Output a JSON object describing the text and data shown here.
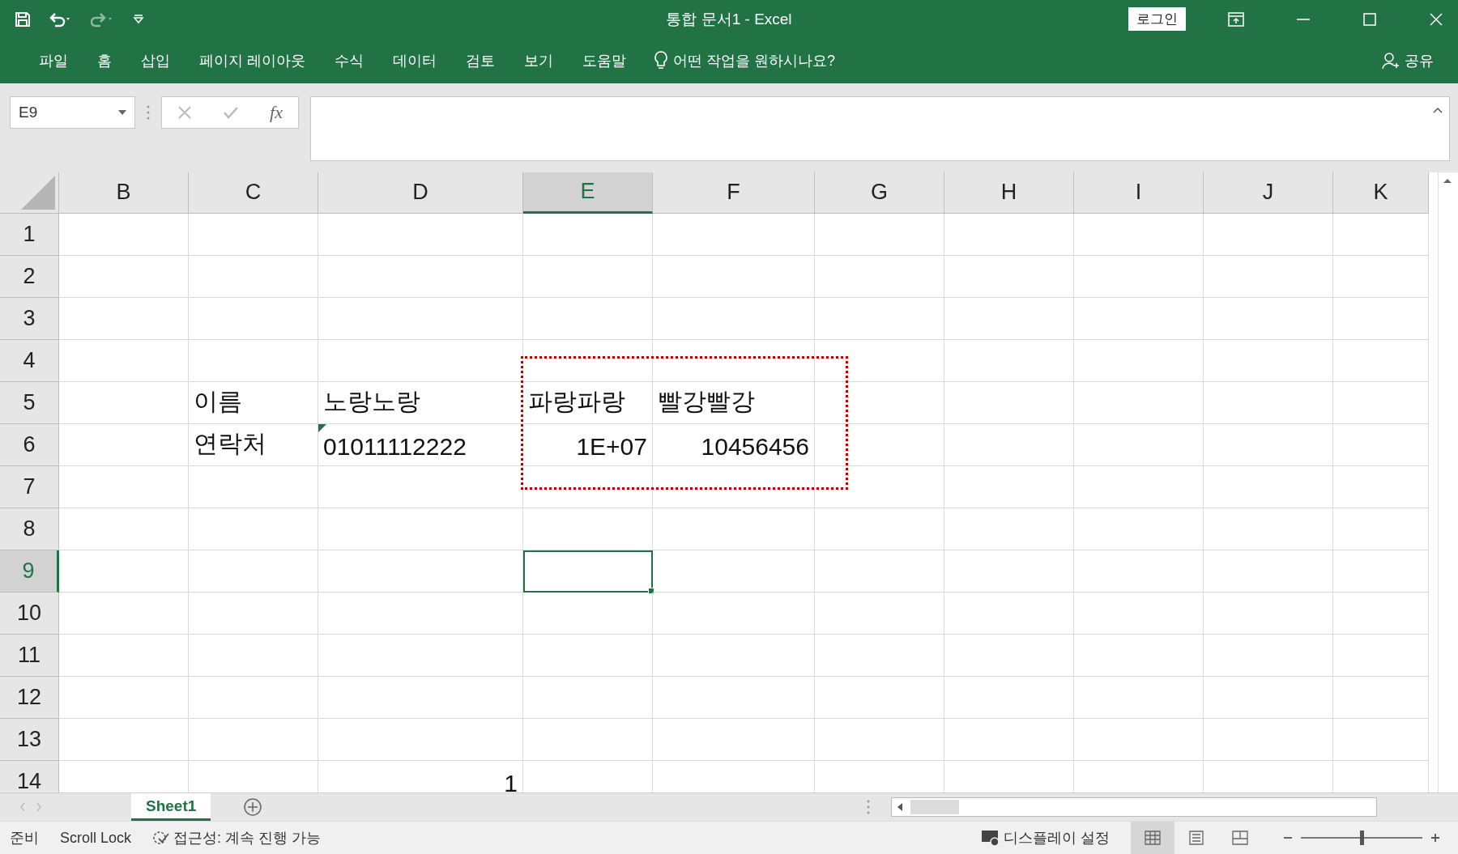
{
  "window": {
    "title": "통합 문서1  -  Excel",
    "login_button": "로그인"
  },
  "ribbon_tabs": [
    "파일",
    "홈",
    "삽입",
    "페이지 레이아웃",
    "수식",
    "데이터",
    "검토",
    "보기",
    "도움말"
  ],
  "tell_me": "어떤 작업을 원하시나요?",
  "share": "공유",
  "name_box": "E9",
  "function_label": "fx",
  "columns": [
    {
      "label": "B",
      "selected": false
    },
    {
      "label": "C",
      "selected": false
    },
    {
      "label": "D",
      "selected": false
    },
    {
      "label": "E",
      "selected": true
    },
    {
      "label": "F",
      "selected": false
    },
    {
      "label": "G",
      "selected": false
    },
    {
      "label": "H",
      "selected": false
    },
    {
      "label": "I",
      "selected": false
    },
    {
      "label": "J",
      "selected": false
    },
    {
      "label": "K",
      "selected": false
    }
  ],
  "rows": [
    {
      "label": "1",
      "selected": false
    },
    {
      "label": "2",
      "selected": false
    },
    {
      "label": "3",
      "selected": false
    },
    {
      "label": "4",
      "selected": false
    },
    {
      "label": "5",
      "selected": false,
      "cells": [
        null,
        {
          "text": "이름",
          "numeric": false
        },
        {
          "text": "노랑노랑",
          "numeric": false
        },
        {
          "text": "파랑파랑",
          "numeric": false
        },
        {
          "text": "빨강빨강",
          "numeric": false
        }
      ]
    },
    {
      "label": "6",
      "selected": false,
      "cells": [
        null,
        {
          "text": "연락처",
          "numeric": false
        },
        {
          "text": "01011112222",
          "numeric": false,
          "error_marker": true
        },
        {
          "text": "1E+07",
          "numeric": true
        },
        {
          "text": "10456456",
          "numeric": true
        }
      ]
    },
    {
      "label": "7",
      "selected": false
    },
    {
      "label": "8",
      "selected": false
    },
    {
      "label": "9",
      "selected": true,
      "cells": [
        null,
        null,
        null,
        {
          "selected": true
        }
      ]
    },
    {
      "label": "10",
      "selected": false
    },
    {
      "label": "11",
      "selected": false
    },
    {
      "label": "12",
      "selected": false
    },
    {
      "label": "13",
      "selected": false
    },
    {
      "label": "14",
      "selected": false,
      "cells": [
        null,
        null,
        {
          "text": "1",
          "numeric": true
        }
      ]
    }
  ],
  "sheet_tabs": [
    {
      "label": "Sheet1",
      "selected": true
    }
  ],
  "status_bar": {
    "mode": "준비",
    "scroll_lock": "Scroll Lock",
    "accessibility": "접근성: 계속 진행 가능",
    "display_settings": "디스플레이 설정",
    "views": [
      {
        "kind": "normal",
        "selected": true
      },
      {
        "kind": "layout",
        "selected": false
      },
      {
        "kind": "break",
        "selected": false
      }
    ],
    "zoom": {
      "level": 0.5
    }
  }
}
